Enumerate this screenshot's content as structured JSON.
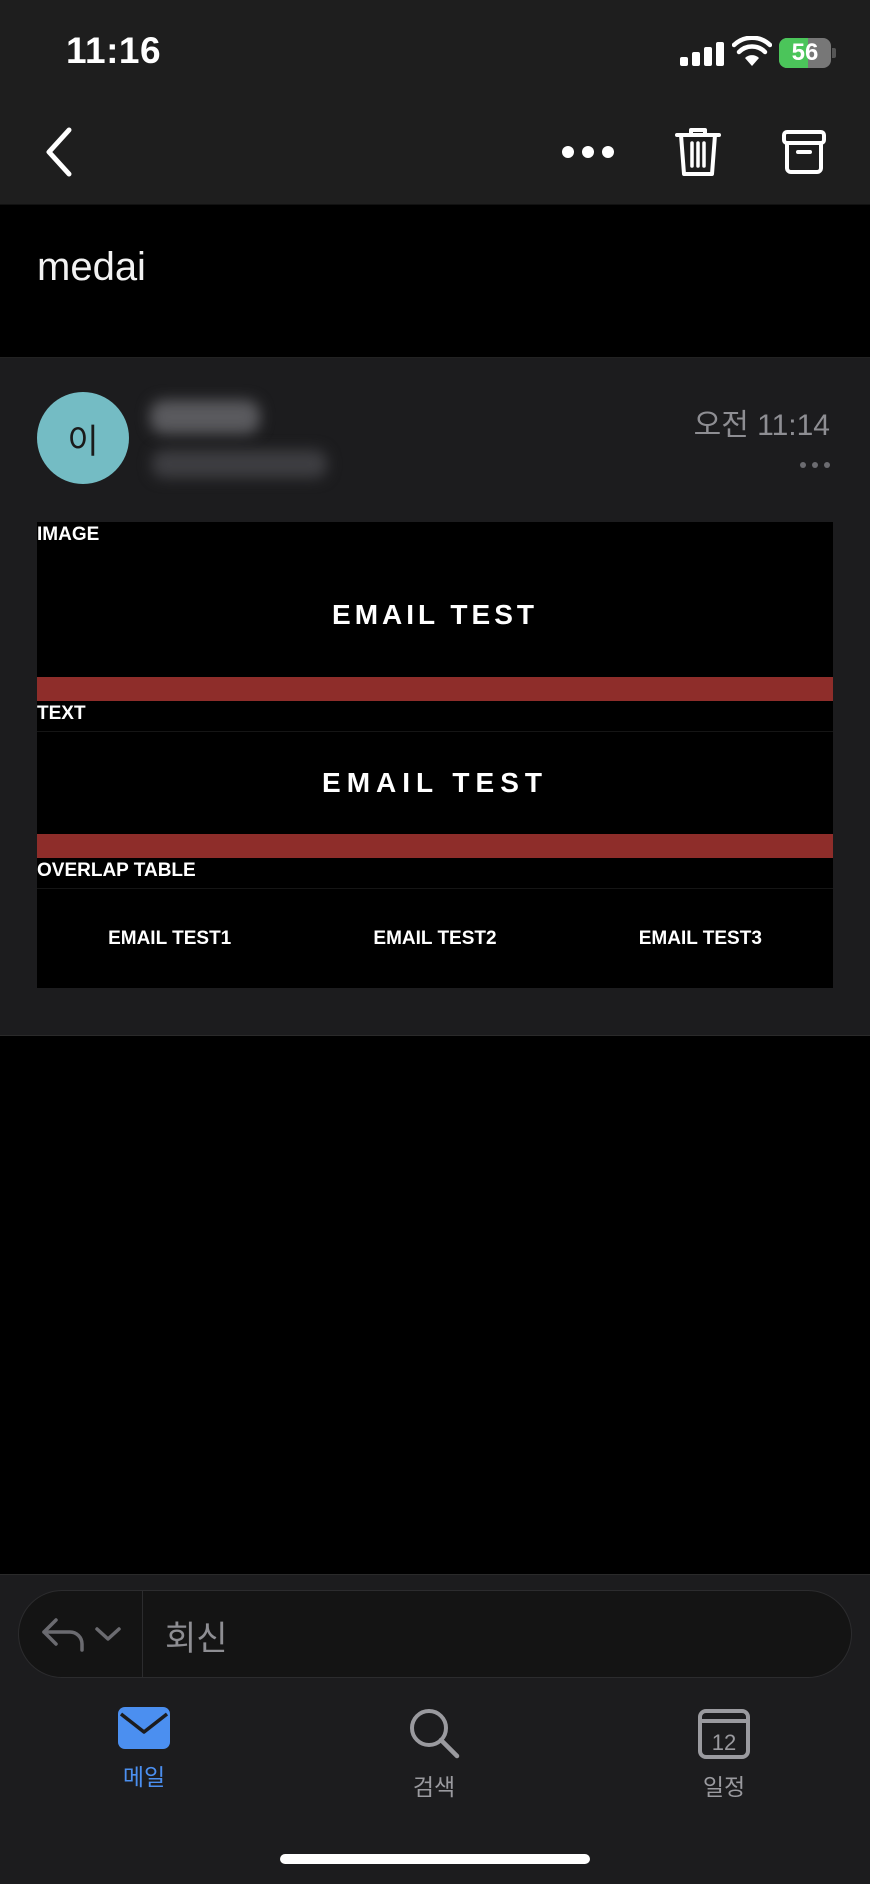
{
  "status_bar": {
    "time": "11:16",
    "battery_percent": "56",
    "battery_level": 0.56,
    "icons": [
      "cellular-signal-icon",
      "wifi-icon",
      "battery-charging-icon"
    ]
  },
  "toolbar": {
    "icons": [
      "chevron-left-icon",
      "more-horizontal-icon",
      "trash-icon",
      "archive-icon"
    ]
  },
  "subject": "medai",
  "message": {
    "avatar_initial": "이",
    "time": "오전 11:14",
    "body": {
      "image_label": "IMAGE",
      "image_banner": "EMAIL TEST",
      "text_label": "TEXT",
      "text_banner": "EMAIL TEST",
      "overlap_label": "OVERLAP TABLE",
      "overlap_cells": [
        "EMAIL TEST1",
        "EMAIL TEST2",
        "EMAIL TEST3"
      ],
      "divider_color": "#8e2d2a"
    }
  },
  "reply": {
    "placeholder": "회신",
    "icons": [
      "reply-icon",
      "chevron-down-icon"
    ]
  },
  "tabbar": {
    "tabs": [
      {
        "label": "메일",
        "icon": "mail-icon",
        "active": true
      },
      {
        "label": "검색",
        "icon": "search-icon",
        "active": false
      },
      {
        "label": "일정",
        "icon": "calendar-icon",
        "active": false
      }
    ],
    "calendar_day": "12",
    "accent_color": "#4b8ff0"
  }
}
